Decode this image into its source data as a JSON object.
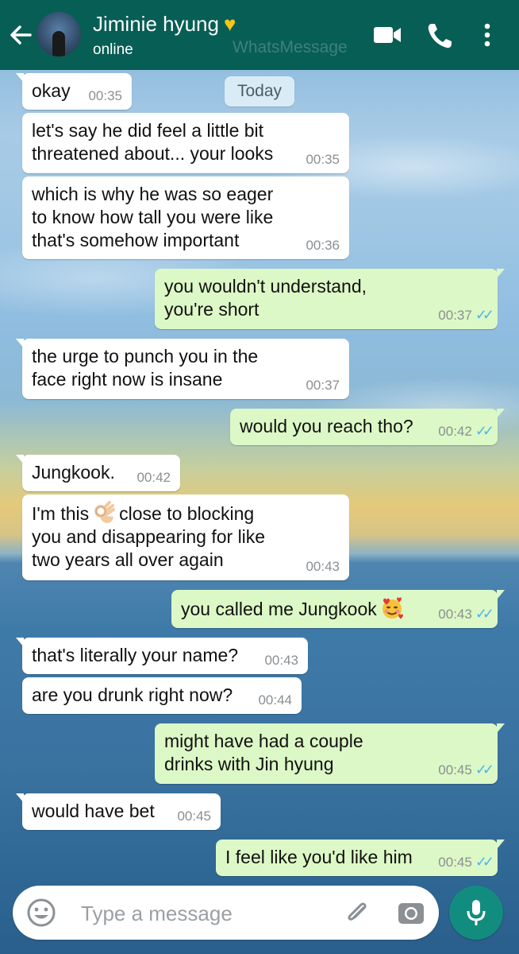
{
  "header": {
    "name": "Jiminie hyung",
    "status": "online",
    "watermark": "WhatsMessage",
    "heart_color": "#f5c518"
  },
  "date_chip": "Today",
  "messages": [
    {
      "dir": "in",
      "text": "okay",
      "time": "00:35"
    },
    {
      "dir": "in",
      "text": "let's say he did feel a little bit\nthreatened about... your looks",
      "time": "00:35"
    },
    {
      "dir": "in",
      "text": "which is why he was so eager\nto know how tall you were like\nthat's somehow important",
      "time": "00:36"
    },
    {
      "dir": "out",
      "text": "you wouldn't understand,\nyou're short",
      "time": "00:37",
      "status": "read"
    },
    {
      "dir": "in",
      "text": "the urge to punch you in the\nface right now is insane",
      "time": "00:37"
    },
    {
      "dir": "out",
      "text": "would you reach tho?",
      "time": "00:42",
      "status": "read"
    },
    {
      "dir": "in",
      "text": "Jungkook.",
      "time": "00:42"
    },
    {
      "dir": "in",
      "text_a": "I'm this",
      "emoji": "ok-hand-emoji",
      "text_b": "close to blocking\nyou and disappearing for like\ntwo years all over again",
      "time": "00:43"
    },
    {
      "dir": "out",
      "text": "you called me Jungkook",
      "emoji": "smiling-face-with-hearts-emoji",
      "time": "00:43",
      "status": "read"
    },
    {
      "dir": "in",
      "text": "that's literally your name?",
      "time": "00:43"
    },
    {
      "dir": "in",
      "text": "are you drunk right now?",
      "time": "00:44"
    },
    {
      "dir": "out",
      "text": "might have had a couple\ndrinks with Jin hyung",
      "time": "00:45",
      "status": "read"
    },
    {
      "dir": "in",
      "text": "would have bet",
      "time": "00:45"
    },
    {
      "dir": "out",
      "text": "I feel like you'd like him",
      "time": "00:45",
      "status": "read"
    }
  ],
  "input": {
    "placeholder": "Type a message"
  },
  "colors": {
    "header_bg": "#075e54",
    "outgoing_bubble": "#dcf8c6",
    "incoming_bubble": "#ffffff",
    "read_tick": "#4fb6ec",
    "mic_button": "#128c7e"
  },
  "ticks": "✓✓"
}
